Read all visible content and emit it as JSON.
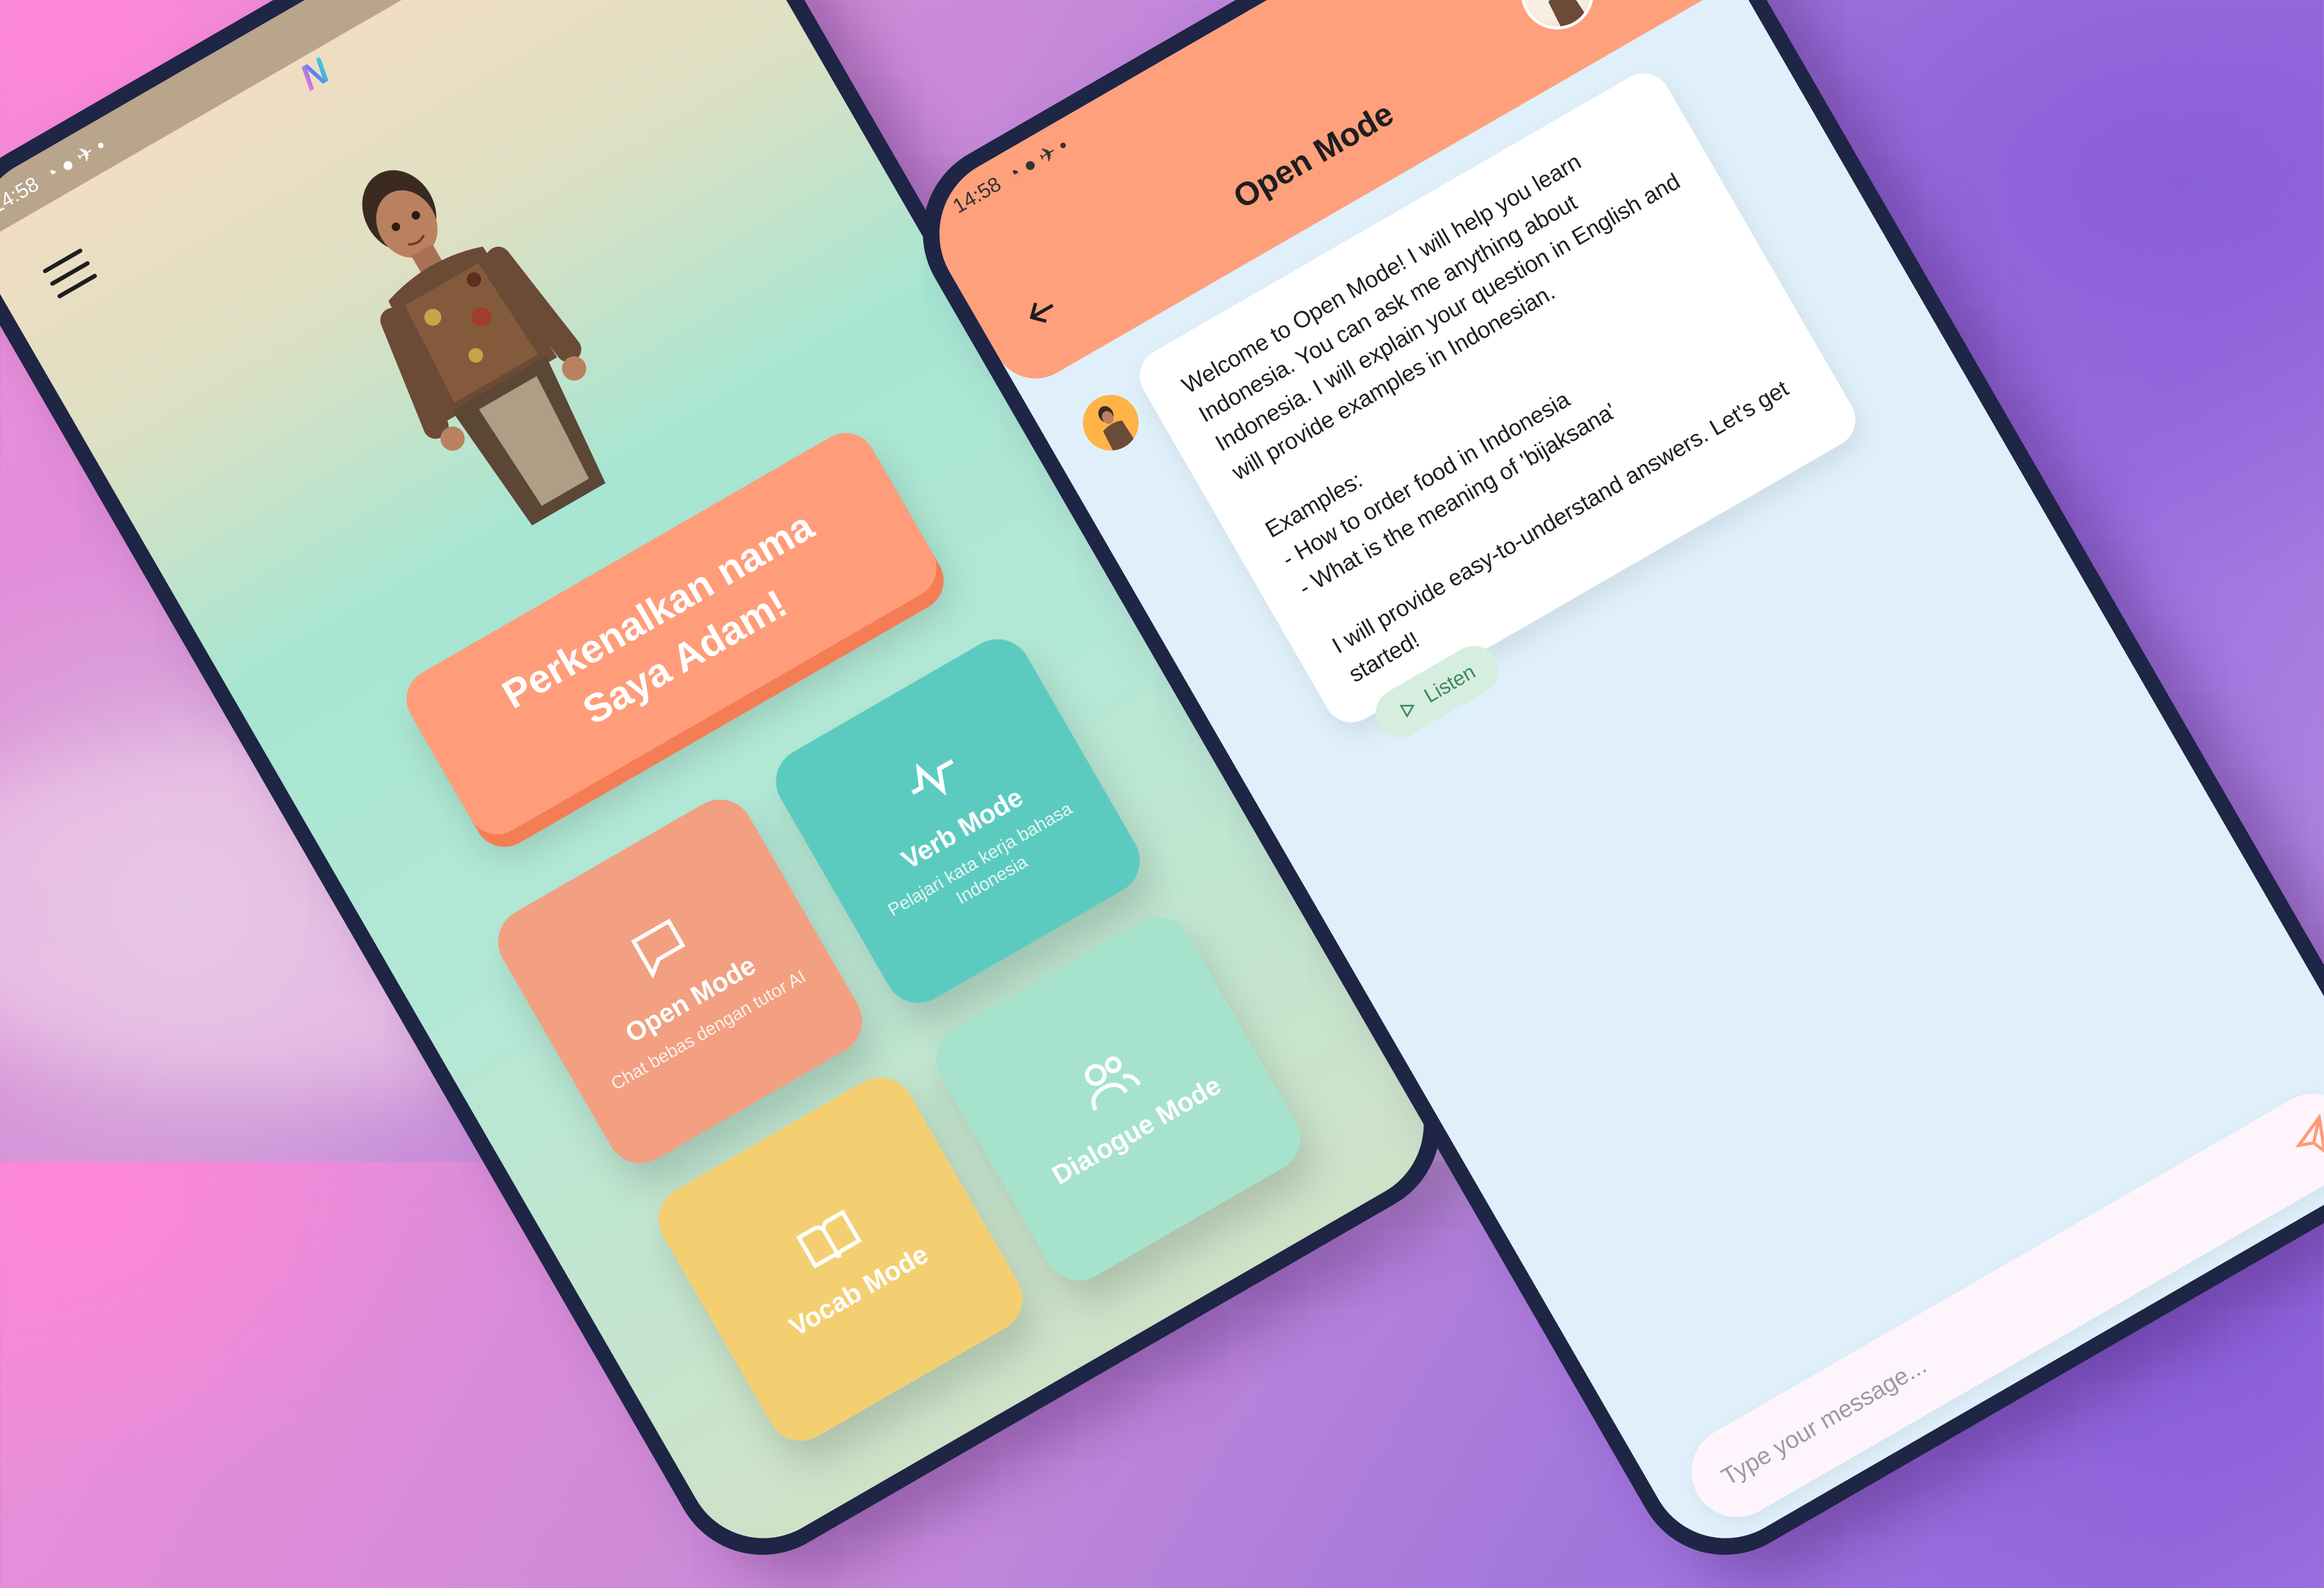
{
  "left_phone": {
    "status_time": "14:58",
    "logo_text": "N",
    "banner_text": "Perkenalkan nama Saya Adam!",
    "modes": [
      {
        "title": "Open Mode",
        "subtitle": "Chat bebas dengan tutor AI",
        "icon": "chat-bubble-icon",
        "color": "#f2a081"
      },
      {
        "title": "Verb Mode",
        "subtitle": "Pelajari kata kerja bahasa Indonesia",
        "icon": "activity-icon",
        "color": "#5ccbbf"
      },
      {
        "title": "Vocab Mode",
        "subtitle": "",
        "icon": "book-icon",
        "color": "#f4cf72"
      },
      {
        "title": "Dialogue Mode",
        "subtitle": "",
        "icon": "users-icon",
        "color": "#a7e3cc"
      }
    ]
  },
  "right_phone": {
    "status_time": "14:58",
    "header_title": "Open Mode",
    "message_text": "Welcome to Open Mode! I will help you learn Indonesia. You can ask me anything about Indonesia. I will explain your question in English and will provide examples in Indonesian.\n\nExamples:\n- How to order food in Indonesia\n- What is the meaning of 'bijaksana'\n\nI will provide easy-to-understand answers. Let's get started!",
    "listen_label": "Listen",
    "input_placeholder": "Type your message...",
    "accent_color": "#ffa07c"
  }
}
